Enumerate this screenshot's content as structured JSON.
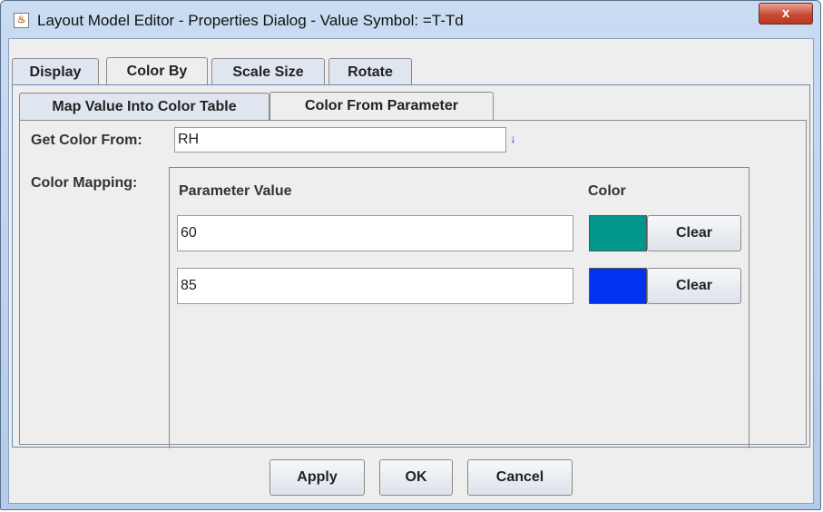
{
  "window": {
    "title": "Layout Model Editor - Properties Dialog - Value Symbol: =T-Td",
    "close_glyph": "x"
  },
  "tabs": [
    "Display",
    "Color By",
    "Scale Size",
    "Rotate"
  ],
  "subtabs": [
    "Map Value Into Color Table",
    "Color From Parameter"
  ],
  "get_color_from": {
    "label": "Get Color From:",
    "value": "RH"
  },
  "color_mapping": {
    "label": "Color Mapping:",
    "col_param": "Parameter Value",
    "col_color": "Color",
    "rows": [
      {
        "value": "60",
        "color": "#00968c",
        "clear_label": "Clear"
      },
      {
        "value": "85",
        "color": "#0032f0",
        "clear_label": "Clear"
      }
    ]
  },
  "buttons": {
    "apply": "Apply",
    "ok": "OK",
    "cancel": "Cancel"
  }
}
